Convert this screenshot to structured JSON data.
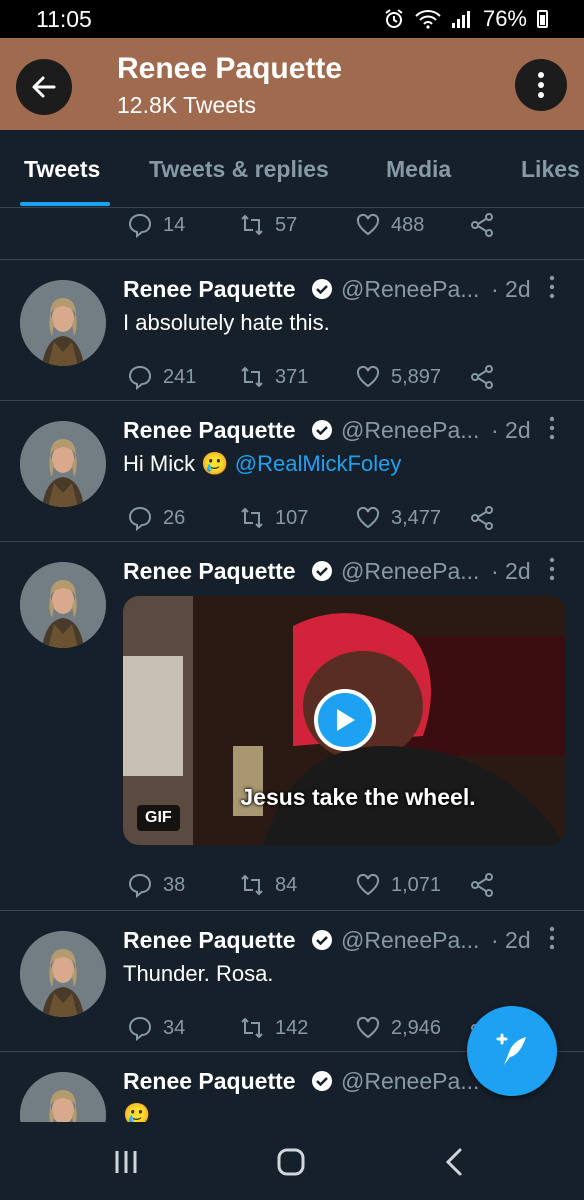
{
  "status_bar": {
    "time": "11:05",
    "battery": "76%"
  },
  "header": {
    "title": "Renee Paquette",
    "subtitle": "12.8K Tweets"
  },
  "tabs": [
    {
      "label": "Tweets",
      "active": true
    },
    {
      "label": "Tweets & replies",
      "active": false
    },
    {
      "label": "Media",
      "active": false
    },
    {
      "label": "Likes",
      "active": false
    }
  ],
  "partial_tweet": {
    "replies": "14",
    "retweets": "57",
    "likes": "488"
  },
  "tweets": [
    {
      "name": "Renee Paquette",
      "handle": "@ReneePa...",
      "time": "· 2d",
      "text": "I absolutely hate this.",
      "replies": "241",
      "retweets": "371",
      "likes": "5,897"
    },
    {
      "name": "Renee Paquette",
      "handle": "@ReneePa...",
      "time": "· 2d",
      "text": "Hi Mick",
      "emoji": "🥲",
      "mention": "@RealMickFoley",
      "replies": "26",
      "retweets": "107",
      "likes": "3,477"
    },
    {
      "name": "Renee Paquette",
      "handle": "@ReneePa...",
      "time": "· 2d",
      "media_caption": "Jesus take the wheel.",
      "media_badge": "GIF",
      "replies": "38",
      "retweets": "84",
      "likes": "1,071"
    },
    {
      "name": "Renee Paquette",
      "handle": "@ReneePa...",
      "time": "· 2d",
      "text": "Thunder. Rosa.",
      "replies": "34",
      "retweets": "142",
      "likes": "2,946"
    },
    {
      "name": "Renee Paquette",
      "handle": "@ReneePa...",
      "time": "",
      "emoji": "🥲"
    }
  ],
  "colors": {
    "background": "#15202b",
    "header": "#a06a4f",
    "accent": "#1da1f2",
    "muted": "#8899a6",
    "divider": "#38444d"
  }
}
